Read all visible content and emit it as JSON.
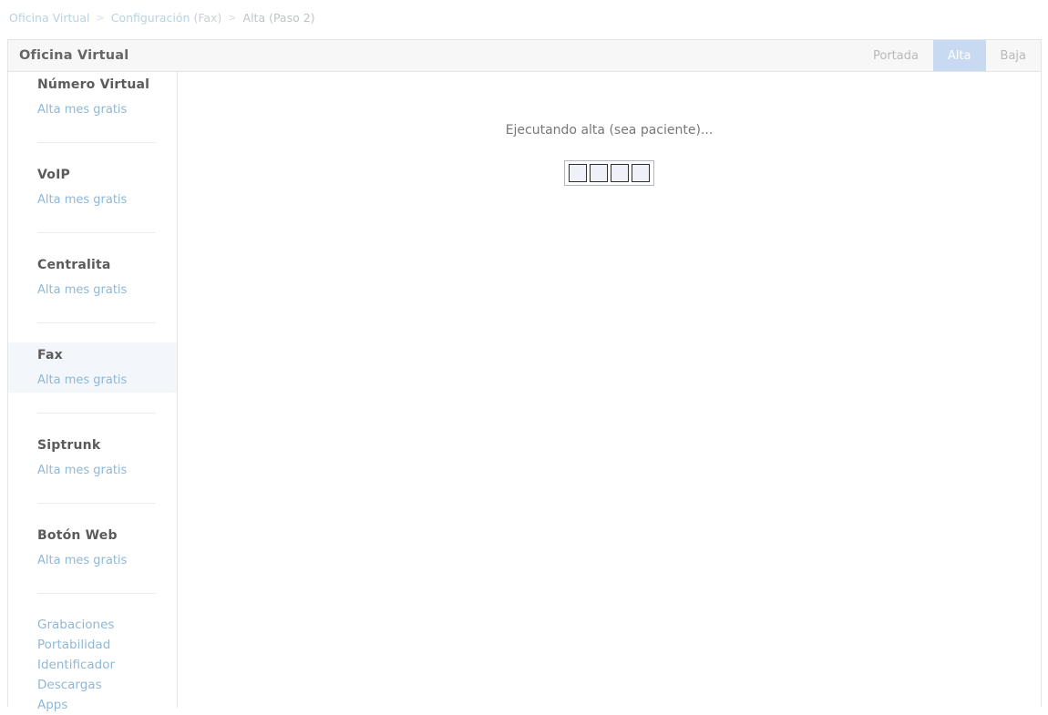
{
  "breadcrumb": {
    "root": "Oficina Virtual",
    "separator": ">",
    "section": "Configuración",
    "section_detail": "(Fax)",
    "current": "Alta (Paso 2)"
  },
  "panel": {
    "title": "Oficina Virtual",
    "tabs": [
      {
        "label": "Portada",
        "active": false
      },
      {
        "label": "Alta",
        "active": true
      },
      {
        "label": "Baja",
        "active": false
      }
    ]
  },
  "sidebar": {
    "groups": [
      {
        "title": "Número Virtual",
        "sub": "Alta mes gratis",
        "selected": false
      },
      {
        "title": "VoIP",
        "sub": "Alta mes gratis",
        "selected": false
      },
      {
        "title": "Centralita",
        "sub": "Alta mes gratis",
        "selected": false
      },
      {
        "title": "Fax",
        "sub": "Alta mes gratis",
        "selected": true
      },
      {
        "title": "Siptrunk",
        "sub": "Alta mes gratis",
        "selected": false
      },
      {
        "title": "Botón Web",
        "sub": "Alta mes gratis",
        "selected": false
      }
    ],
    "extra_links": [
      "Grabaciones",
      "Portabilidad",
      "Identificador",
      "Descargas",
      "Apps"
    ]
  },
  "main": {
    "status_text": "Ejecutando alta (sea paciente)...",
    "loader": {
      "cells": 4,
      "cell_fill": "#eef2f8",
      "cell_border": "#2f2f2f",
      "frame_border": "#aeb7c6"
    }
  },
  "colors": {
    "accent": "#8fb8d6",
    "active_tab_bg": "#c7daf2",
    "selected_row_bg": "#f3f6fa",
    "header_bg": "#f7f7f7",
    "border": "#e4e4e4"
  }
}
